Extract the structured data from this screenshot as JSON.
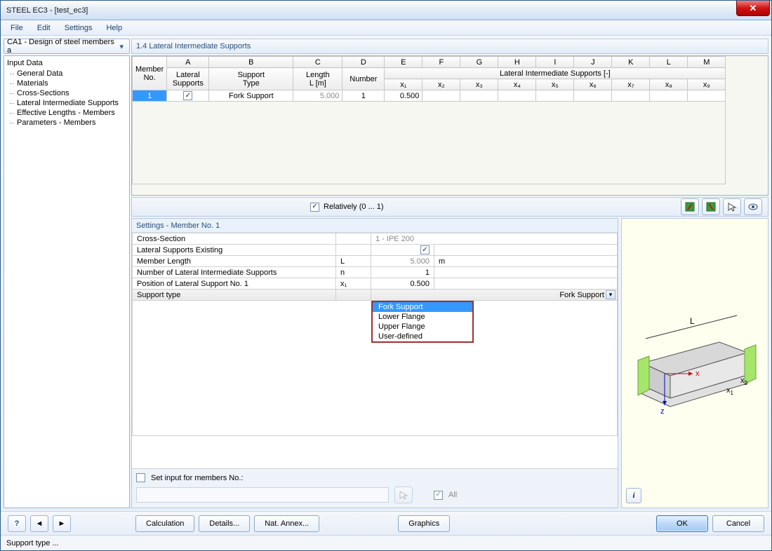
{
  "window": {
    "title": "STEEL EC3 - [test_ec3]"
  },
  "menu": [
    "File",
    "Edit",
    "Settings",
    "Help"
  ],
  "combo": {
    "text": "CA1 - Design of steel members a"
  },
  "tree": {
    "root": "Input Data",
    "items": [
      "General Data",
      "Materials",
      "Cross-Sections",
      "Lateral Intermediate Supports",
      "Effective Lengths - Members",
      "Parameters - Members"
    ]
  },
  "section_title": "1.4 Lateral Intermediate Supports",
  "grid": {
    "letters": [
      "A",
      "B",
      "C",
      "D",
      "E",
      "F",
      "G",
      "H",
      "I",
      "J",
      "K",
      "L",
      "M"
    ],
    "h1": {
      "member_no": "Member\nNo.",
      "lateral_supports": "Lateral\nSupports",
      "support_type": "Support\nType",
      "length": "Length\nL [m]",
      "number": "Number",
      "lis_group": "Lateral Intermediate Supports [-]"
    },
    "xcols": [
      "x₁",
      "x₂",
      "x₃",
      "x₄",
      "x₅",
      "x₆",
      "x₇",
      "x₈",
      "x₉"
    ],
    "row": {
      "no": "1",
      "support_type": "Fork Support",
      "length": "5.000",
      "number": "1",
      "x1": "0.500"
    }
  },
  "relatively": {
    "label": "Relatively (0 ... 1)",
    "checked": true
  },
  "settings": {
    "header": "Settings - Member No. 1",
    "rows": {
      "cross_section": {
        "label": "Cross-Section",
        "sym": "",
        "value": "1 - IPE 200",
        "unit": ""
      },
      "lat_exist": {
        "label": "Lateral Supports Existing",
        "sym": "",
        "value_checked": true,
        "unit": ""
      },
      "member_len": {
        "label": "Member Length",
        "sym": "L",
        "value": "5.000",
        "unit": "m"
      },
      "num_lis": {
        "label": "Number of Lateral Intermediate Supports",
        "sym": "n",
        "value": "1",
        "unit": ""
      },
      "pos1": {
        "label": "Position of Lateral Support No. 1",
        "sym": "x₁",
        "value": "0.500",
        "unit": ""
      },
      "support_type": {
        "label": "Support type",
        "sym": "",
        "value": "Fork Support",
        "unit": ""
      }
    },
    "dropdown_options": [
      "Fork Support",
      "Lower Flange",
      "Upper Flange",
      "User-defined"
    ],
    "set_input_label": "Set input for members No.:",
    "all_label": "All"
  },
  "footer": {
    "calc": "Calculation",
    "details": "Details...",
    "annex": "Nat. Annex...",
    "graphics": "Graphics",
    "ok": "OK",
    "cancel": "Cancel"
  },
  "status": "Support type ..."
}
